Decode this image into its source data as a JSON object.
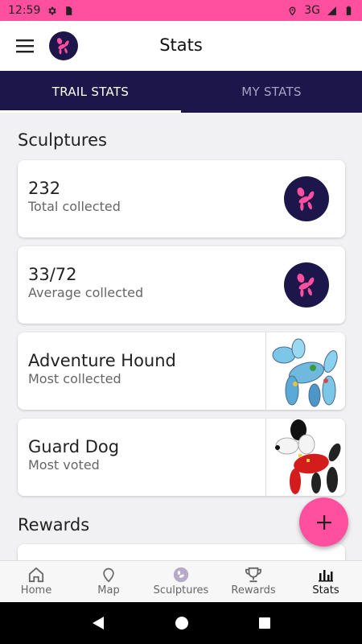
{
  "status_bar": {
    "time": "12:59",
    "network": "3G"
  },
  "app_bar": {
    "title": "Stats"
  },
  "tabs": [
    {
      "label": "TRAIL STATS",
      "active": true
    },
    {
      "label": "MY STATS",
      "active": false
    }
  ],
  "sections": {
    "sculptures_title": "Sculptures",
    "rewards_title": "Rewards"
  },
  "cards": [
    {
      "value": "232",
      "label": "Total collected"
    },
    {
      "value": "33/72",
      "label": "Average collected"
    },
    {
      "value": "Adventure Hound",
      "label": "Most collected"
    },
    {
      "value": "Guard Dog",
      "label": "Most voted"
    }
  ],
  "bottom_nav": [
    {
      "label": "Home",
      "icon": "home-icon"
    },
    {
      "label": "Map",
      "icon": "map-pin-icon"
    },
    {
      "label": "Sculptures",
      "icon": "sculpture-logo-icon"
    },
    {
      "label": "Rewards",
      "icon": "trophy-icon"
    },
    {
      "label": "Stats",
      "icon": "bar-chart-icon",
      "active": true
    }
  ],
  "colors": {
    "brand_pink": "#ff4f9e",
    "brand_navy": "#1d164a"
  }
}
